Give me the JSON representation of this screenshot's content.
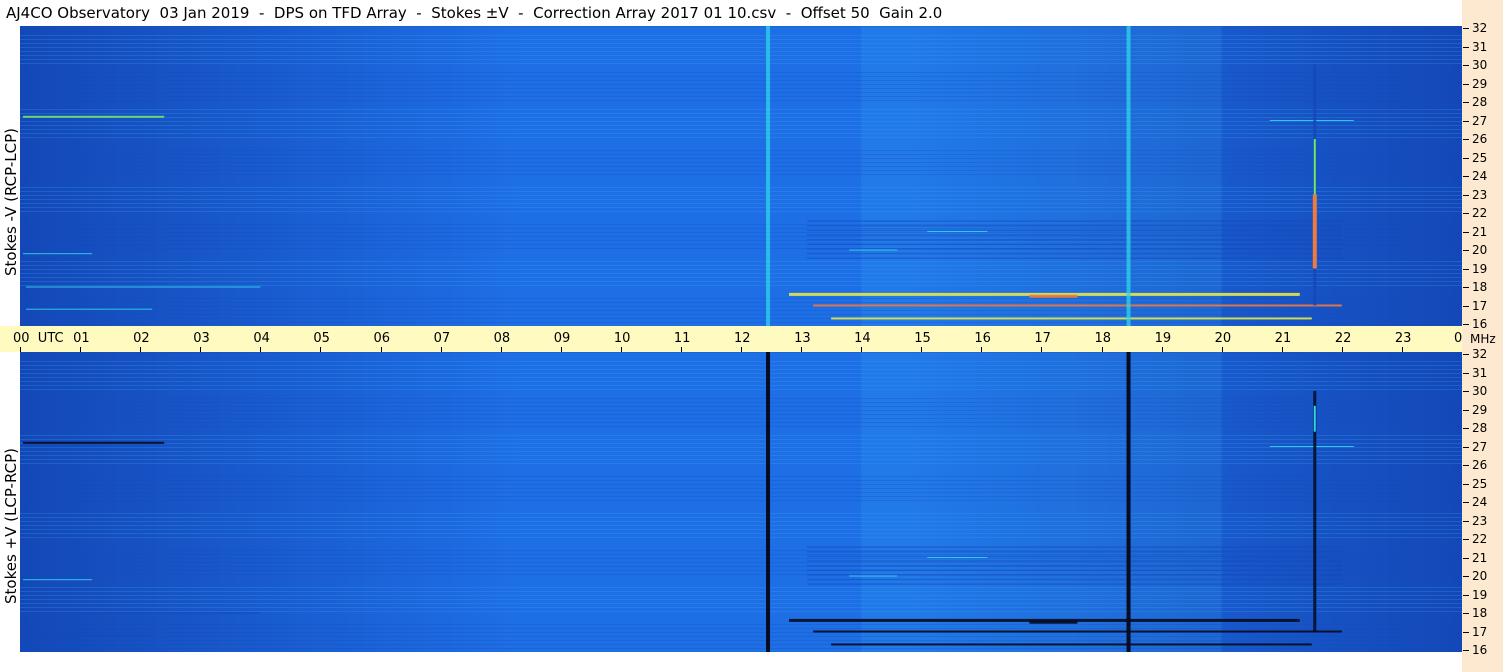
{
  "title": "AJ4CO Observatory  03 Jan 2019  -  DPS on TFD Array  -  Stokes ±V  -  Correction Array 2017 01 10.csv  -  Offset 50  Gain 2.0",
  "panels": {
    "top_label": "Stokes -V (RCP-LCP)",
    "bottom_label": "Stokes +V (LCP-RCP)"
  },
  "colors": {
    "background_blue": "#1e6fe6",
    "dark_blue": "#1448b8",
    "light_blue": "#39a6f2",
    "cyan": "#2fd6ea",
    "green": "#6fe86a",
    "yellow": "#e8e846",
    "orange": "#f07a3c",
    "black_band": "#050b20",
    "time_axis_bg": "#fffbc0",
    "freq_axis_bg": "#fde8d0"
  },
  "chart_data": {
    "type": "heatmap",
    "title": "AJ4CO Observatory  03 Jan 2019  -  DPS on TFD Array  -  Stokes ±V  -  Correction Array 2017 01 10.csv  -  Offset 50  Gain 2.0",
    "x_axis": {
      "unit": "UTC",
      "range": [
        0,
        24
      ],
      "tick_labels": [
        "00",
        "01",
        "02",
        "03",
        "04",
        "05",
        "06",
        "07",
        "08",
        "09",
        "10",
        "11",
        "12",
        "13",
        "14",
        "15",
        "16",
        "17",
        "18",
        "19",
        "20",
        "21",
        "22",
        "23",
        "00"
      ],
      "first_label_suffix": "UTC"
    },
    "y_axis": {
      "unit": "MHz",
      "range": [
        16,
        32
      ],
      "tick_labels": [
        "32",
        "31",
        "30",
        "29",
        "28",
        "27",
        "26",
        "25",
        "24",
        "23",
        "22",
        "21",
        "20",
        "19",
        "18",
        "17",
        "16"
      ]
    },
    "panels": [
      "Stokes -V (RCP-LCP)",
      "Stokes +V (LCP-RCP)"
    ],
    "features": {
      "vertical_lines_utc": [
        12.45,
        18.45
      ],
      "burst_utc": 21.55,
      "burst_top_mhz": [
        30,
        28
      ],
      "burst_bright_mhz": [
        23,
        19
      ],
      "interference_mhz": [
        17.5,
        18,
        17,
        16.2,
        21,
        20,
        27.1
      ],
      "daytime_interference_utc": [
        12.8,
        22.0
      ]
    }
  }
}
